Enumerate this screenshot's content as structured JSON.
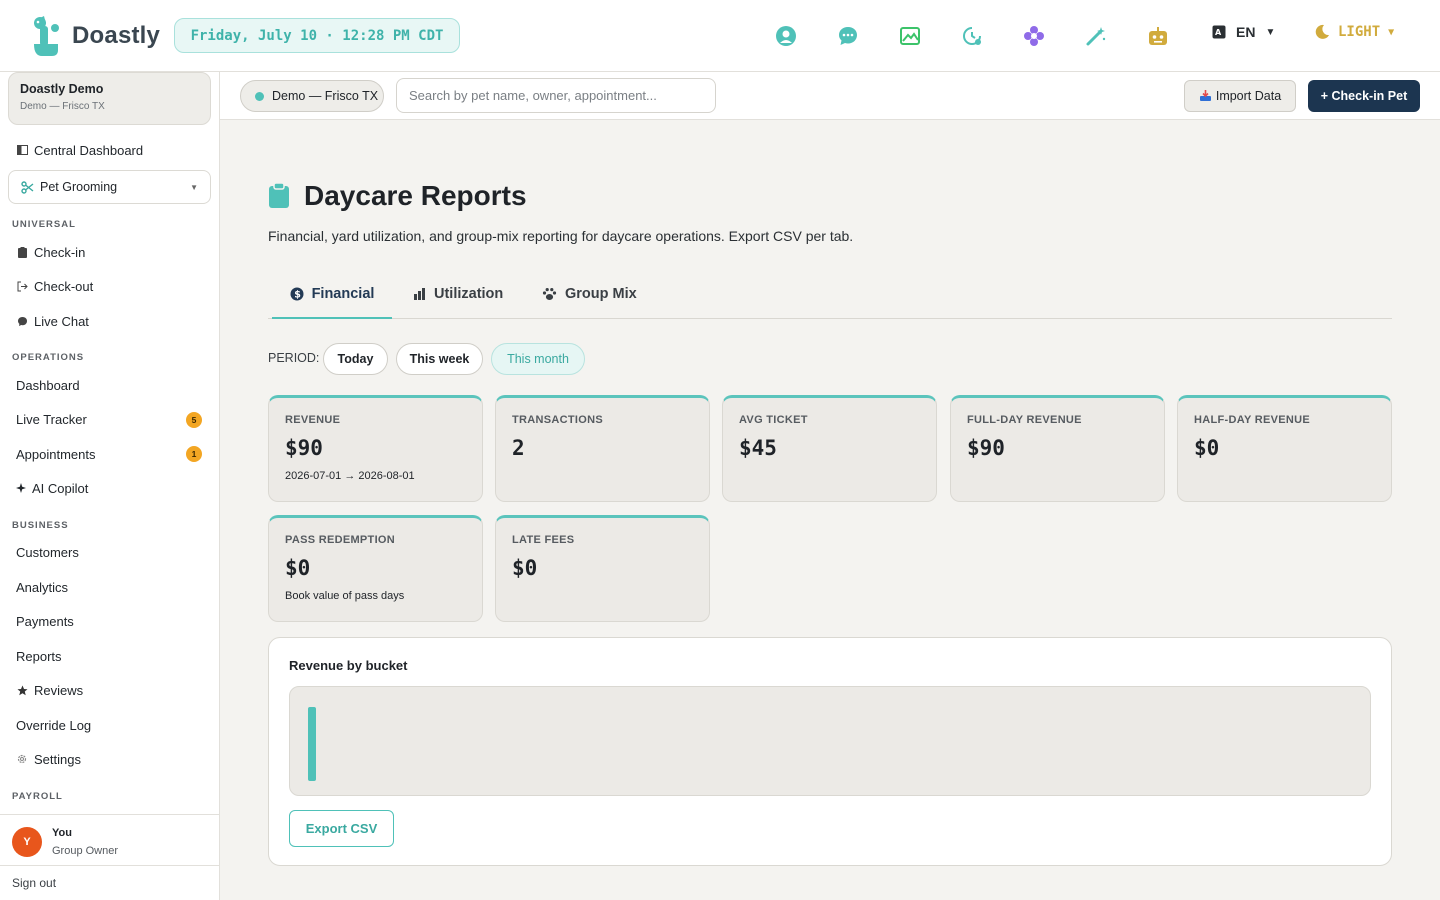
{
  "app": {
    "brand": "Doastly",
    "datetime": "Friday, July 10 · 12:28 PM CDT",
    "language": "EN",
    "theme_label": "LIGHT",
    "colors": {
      "accent": "#4fc1b8",
      "primary": "#1c3550",
      "badge": "#f3a623",
      "avatar": "#e8561c",
      "theme": "#d1ab3d"
    },
    "top_icons": [
      "support-icon",
      "chat-bubble-icon",
      "image-icon",
      "clock-history-icon",
      "flower-icon",
      "magic-wand-icon",
      "robot-icon"
    ]
  },
  "sidebar": {
    "org_name": "Doastly Demo",
    "org_location": "Demo — Frisco TX",
    "central_dashboard": "Central Dashboard",
    "module": "Pet Grooming",
    "sections": {
      "universal": "UNIVERSAL",
      "operations": "OPERATIONS",
      "business": "BUSINESS",
      "payroll": "PAYROLL"
    },
    "universal_items": [
      {
        "label": "Check-in"
      },
      {
        "label": "Check-out"
      },
      {
        "label": "Live Chat"
      }
    ],
    "operations_items": [
      {
        "label": "Dashboard",
        "badge": ""
      },
      {
        "label": "Live Tracker",
        "badge": "5"
      },
      {
        "label": "Appointments",
        "badge": "1"
      },
      {
        "label": "AI Copilot",
        "badge": ""
      }
    ],
    "business_items": [
      {
        "label": "Customers"
      },
      {
        "label": "Analytics"
      },
      {
        "label": "Payments"
      },
      {
        "label": "Reports"
      },
      {
        "label": "Reviews"
      },
      {
        "label": "Override Log"
      },
      {
        "label": "Settings"
      }
    ],
    "user": {
      "initial": "Y",
      "name": "You",
      "role": "Group Owner"
    },
    "sign_out": "Sign out"
  },
  "subheader": {
    "location": "Demo — Frisco TX",
    "search_placeholder": "Search by pet name, owner, appointment...",
    "import_label": "Import Data",
    "checkin_label": "+ Check-in Pet"
  },
  "main": {
    "title": "Daycare Reports",
    "description": "Financial, yard utilization, and group-mix reporting for daycare operations. Export CSV per tab.",
    "tabs": [
      {
        "label": "Financial",
        "active": true
      },
      {
        "label": "Utilization",
        "active": false
      },
      {
        "label": "Group Mix",
        "active": false
      }
    ],
    "period_label": "PERIOD:",
    "periods": [
      {
        "label": "Today",
        "active": false
      },
      {
        "label": "This week",
        "active": false
      },
      {
        "label": "This month",
        "active": true
      }
    ],
    "cards": [
      {
        "label": "REVENUE",
        "value": "$90",
        "sub": "2026-07-01 → 2026-08-01"
      },
      {
        "label": "TRANSACTIONS",
        "value": "2",
        "sub": ""
      },
      {
        "label": "AVG TICKET",
        "value": "$45",
        "sub": ""
      },
      {
        "label": "FULL-DAY REVENUE",
        "value": "$90",
        "sub": ""
      },
      {
        "label": "HALF-DAY REVENUE",
        "value": "$0",
        "sub": ""
      },
      {
        "label": "PASS REDEMPTION",
        "value": "$0",
        "sub": "Book value of pass days"
      },
      {
        "label": "LATE FEES",
        "value": "$0",
        "sub": ""
      }
    ],
    "panel_title": "Revenue by bucket",
    "export_label": "Export CSV"
  },
  "chart_data": {
    "type": "bar",
    "categories": [
      ""
    ],
    "values": [
      90
    ],
    "title": "Revenue by bucket"
  }
}
